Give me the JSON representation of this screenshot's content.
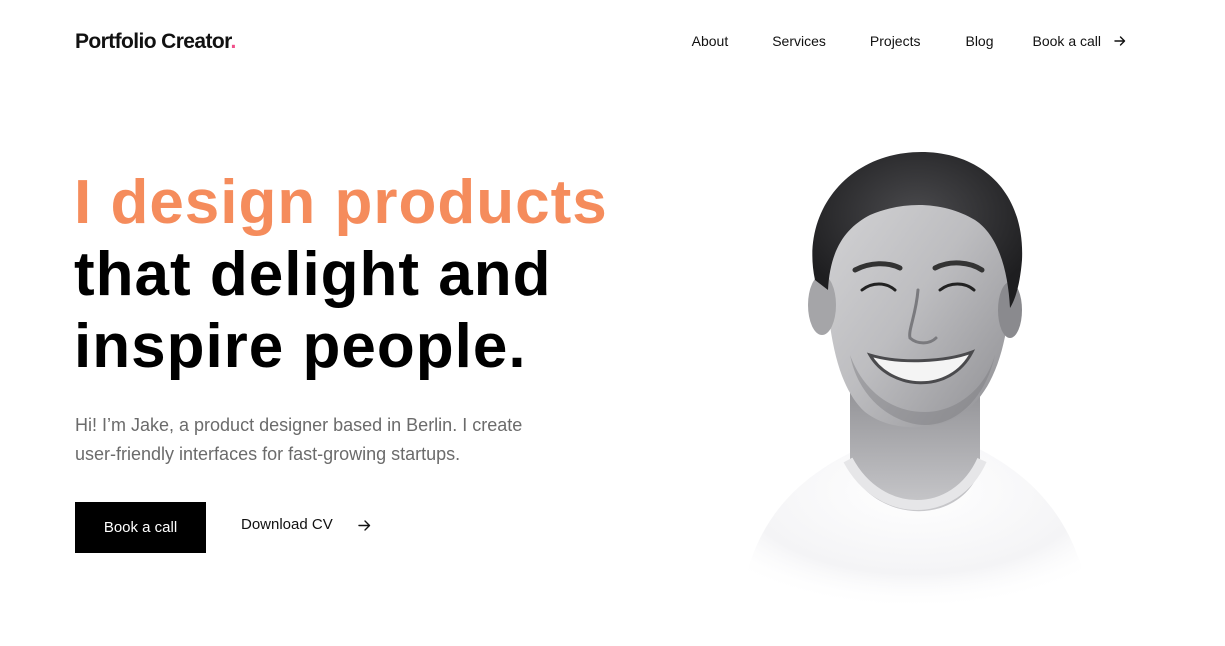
{
  "header": {
    "logo": "Portfolio Creator",
    "logo_dot": ".",
    "nav": {
      "about": "About",
      "services": "Services",
      "projects": "Projects",
      "blog": "Blog",
      "cta": "Book a call"
    }
  },
  "hero": {
    "headline_accent": "I design products",
    "headline_line2": "that delight and",
    "headline_line3": "inspire people.",
    "intro_line1": "Hi! I’m Jake, a product designer based in Berlin. I create",
    "intro_line2": "user-friendly interfaces for fast-growing startups.",
    "primary_button": "Book a call",
    "secondary_button": "Download CV"
  },
  "colors": {
    "accent": "#f58c5c",
    "logo_dot": "#f0508a",
    "button_bg": "#000000",
    "body_text": "#6b6b6b"
  },
  "icons": {
    "nav_cta": "arrow-right-icon",
    "download": "arrow-right-icon"
  }
}
